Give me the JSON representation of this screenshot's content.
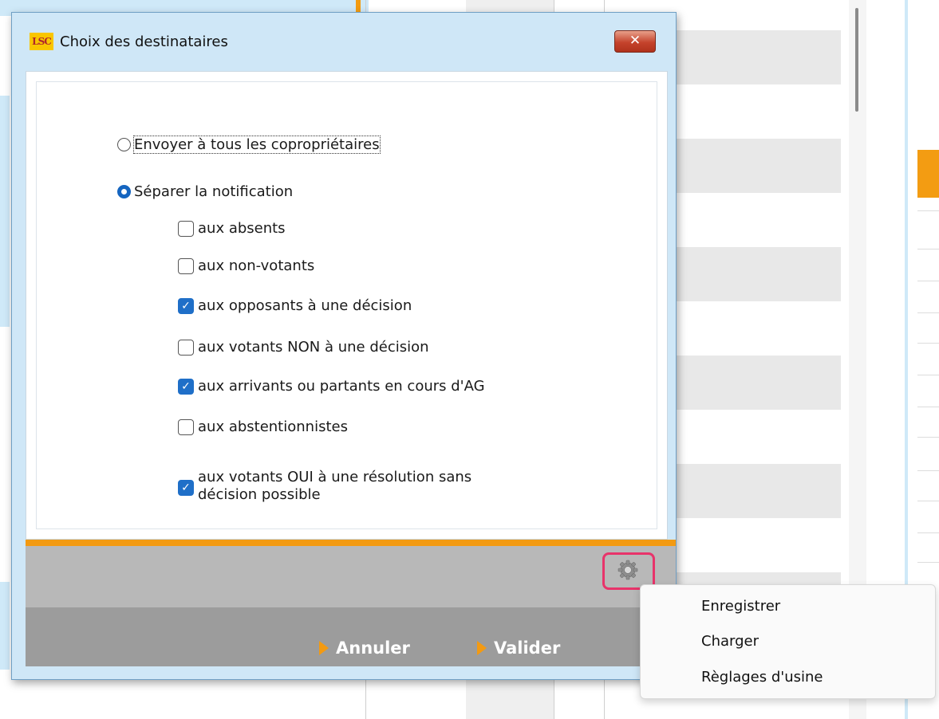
{
  "dialog": {
    "title": "Choix des destinataires",
    "logo_text": "LSC",
    "close_glyph": "✕",
    "radio_all_label": "Envoyer à tous les copropriétaires",
    "radio_all_selected": false,
    "radio_separate_label": "Séparer la notification",
    "radio_separate_selected": true,
    "checkboxes": [
      {
        "label": "aux absents",
        "checked": false
      },
      {
        "label": "aux non-votants",
        "checked": false
      },
      {
        "label": "aux opposants à une décision",
        "checked": true
      },
      {
        "label": "aux votants NON à une décision",
        "checked": false
      },
      {
        "label": "aux arrivants ou partants en cours d'AG",
        "checked": true
      },
      {
        "label": "aux abstentionnistes",
        "checked": false
      },
      {
        "label": "aux votants OUI à une résolution sans",
        "label_line2": "décision possible",
        "checked": true
      }
    ],
    "settings_icon": "gear-icon",
    "cancel_label": "Annuler",
    "ok_label": "Valider"
  },
  "context_menu": {
    "items": [
      {
        "label": "Enregistrer"
      },
      {
        "label": "Charger"
      },
      {
        "label": "Règlages d'usine"
      }
    ]
  },
  "colors": {
    "accent_orange": "#f39a12",
    "checkbox_blue": "#1f6fc8",
    "highlight_pink": "#e8336a",
    "dialog_bg": "#cfe7f7"
  }
}
